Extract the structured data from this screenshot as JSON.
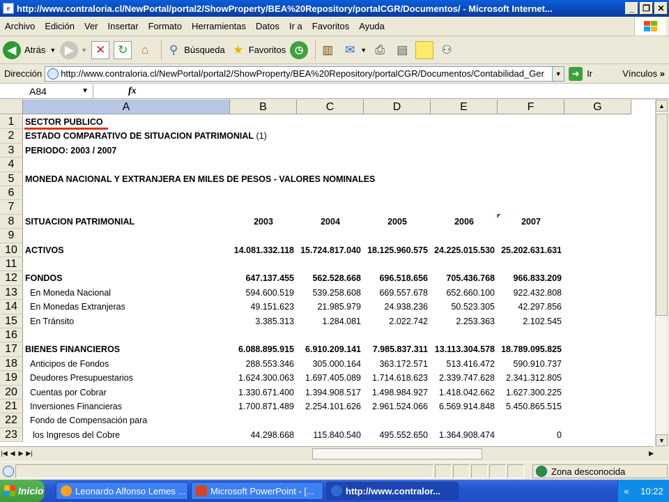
{
  "window": {
    "title": "http://www.contraloria.cl/NewPortal/portal2/ShowProperty/BEA%20Repository/portalCGR/Documentos/ - Microsoft Internet..."
  },
  "menu": [
    "Archivo",
    "Edición",
    "Ver",
    "Insertar",
    "Formato",
    "Herramientas",
    "Datos",
    "Ir a",
    "Favoritos",
    "Ayuda"
  ],
  "toolbar": {
    "back_label": "Atrás",
    "search_label": "Búsqueda",
    "favorites_label": "Favoritos"
  },
  "address": {
    "label": "Dirección",
    "url": "http://www.contraloria.cl/NewPortal/portal2/ShowProperty/BEA%20Repository/portalCGR/Documentos/Contabilidad_Ger",
    "go_label": "Ir",
    "links_label": "Vínculos"
  },
  "formula_bar": {
    "name_box": "A84",
    "fx": "fx"
  },
  "columns": [
    "A",
    "B",
    "C",
    "D",
    "E",
    "F",
    "G"
  ],
  "rows": [
    {
      "n": "1",
      "a": "SECTOR PUBLICO",
      "bold": true,
      "vals": []
    },
    {
      "n": "2",
      "a": "ESTADO COMPARATIVO DE SITUACION PATRIMONIAL",
      "a_suffix": " (1)",
      "bold": true,
      "vals": []
    },
    {
      "n": "3",
      "a": "PERIODO:  2003 / 2007",
      "bold": true,
      "vals": []
    },
    {
      "n": "4",
      "a": "",
      "vals": []
    },
    {
      "n": "5",
      "a": "MONEDA NACIONAL Y EXTRANJERA EN MILES DE PESOS - VALORES NOMINALES",
      "bold": true,
      "vals": []
    },
    {
      "n": "6",
      "a": "",
      "vals": []
    },
    {
      "n": "7",
      "a": "",
      "vals": []
    },
    {
      "n": "8",
      "a": "SITUACION PATRIMONIAL",
      "bold": true,
      "vals": [
        "2003",
        "2004",
        "2005",
        "2006",
        "2007"
      ],
      "center": true
    },
    {
      "n": "9",
      "a": "",
      "vals": []
    },
    {
      "n": "10",
      "a": "ACTIVOS",
      "bold": true,
      "vals": [
        "14.081.332.118",
        "15.724.817.040",
        "18.125.960.575",
        "24.225.015.530",
        "25.202.631.631"
      ]
    },
    {
      "n": "11",
      "a": "",
      "vals": []
    },
    {
      "n": "12",
      "a": "FONDOS",
      "bold": true,
      "vals": [
        "647.137.455",
        "562.528.668",
        "696.518.656",
        "705.436.768",
        "966.833.209"
      ]
    },
    {
      "n": "13",
      "a": "En Moneda Nacional",
      "indent": true,
      "vals": [
        "594.600.519",
        "539.258.608",
        "669.557.678",
        "652.660.100",
        "922.432.808"
      ]
    },
    {
      "n": "14",
      "a": "En Monedas Extranjeras",
      "indent": true,
      "vals": [
        "49.151.623",
        "21.985.979",
        "24.938.236",
        "50.523.305",
        "42.297.856"
      ]
    },
    {
      "n": "15",
      "a": "En Tránsito",
      "indent": true,
      "vals": [
        "3.385.313",
        "1.284.081",
        "2.022.742",
        "2.253.363",
        "2.102.545"
      ]
    },
    {
      "n": "16",
      "a": "",
      "vals": []
    },
    {
      "n": "17",
      "a": "BIENES FINANCIEROS",
      "bold": true,
      "vals": [
        "6.088.895.915",
        "6.910.209.141",
        "7.985.837.311",
        "13.113.304.578",
        "18.789.095.825"
      ]
    },
    {
      "n": "18",
      "a": "Anticipos de Fondos",
      "indent": true,
      "vals": [
        "288.553.346",
        "305.000.164",
        "363.172.571",
        "513.416.472",
        "590.910.737"
      ]
    },
    {
      "n": "19",
      "a": "Deudores Presupuestarios",
      "indent": true,
      "vals": [
        "1.624.300.063",
        "1.697.405.089",
        "1.714.618.623",
        "2.339.747.628",
        "2.341.312.805"
      ]
    },
    {
      "n": "20",
      "a": "Cuentas por Cobrar",
      "indent": true,
      "vals": [
        "1.330.671.400",
        "1.394.908.517",
        "1.498.984.927",
        "1.418.042.662",
        "1.627.300.225"
      ]
    },
    {
      "n": "21",
      "a": "Inversiones Financieras",
      "indent": true,
      "vals": [
        "1.700.871.489",
        "2.254.101.626",
        "2.961.524.066",
        "6.569.914.848",
        "5.450.865.515"
      ]
    },
    {
      "n": "22",
      "a": "Fondo de Compensación para",
      "indent": true,
      "vals": []
    },
    {
      "n": "23",
      "a": "los Ingresos del Cobre",
      "indent2": true,
      "vals": [
        "44.298.668",
        "115.840.540",
        "495.552.650",
        "1.364.908.474",
        "0"
      ]
    }
  ],
  "status": {
    "zone": "Zona desconocida"
  },
  "taskbar": {
    "start": "Inicio",
    "tasks": [
      {
        "label": "Leonardo Alfonso Lemes ...",
        "color": "#f7a21b"
      },
      {
        "label": "Microsoft PowerPoint - [...",
        "color": "#d24726"
      },
      {
        "label": "http://www.contralor...",
        "color": "#2a6cd1",
        "active": true
      }
    ],
    "tray_arrow": "«",
    "clock": "10:22"
  }
}
